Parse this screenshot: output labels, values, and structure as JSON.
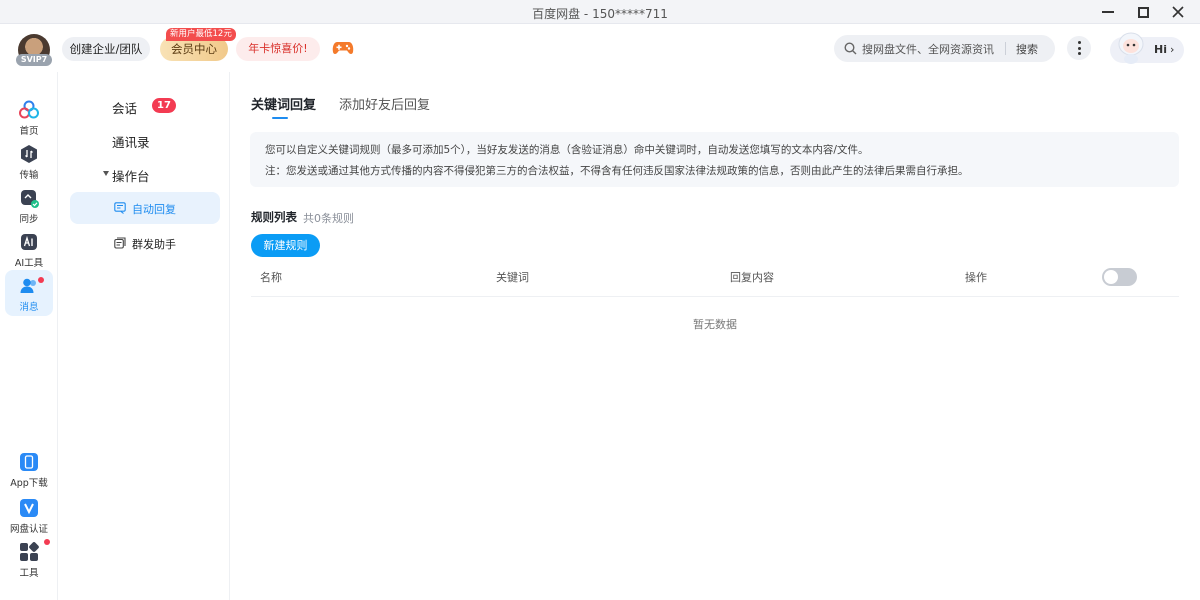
{
  "window": {
    "title": "百度网盘 - 150*****711"
  },
  "header": {
    "vip_tag": "SVIP7",
    "enterprise_label": "创建企业/团队",
    "member_label": "会员中心",
    "new_user_badge": "新用户最低12元",
    "promo_label": "年卡惊喜价!",
    "search_placeholder": "搜网盘文件、全网资源资讯",
    "search_button": "搜索",
    "hi_label": "Hi",
    "hi_chevron": "›"
  },
  "rail": {
    "items": [
      {
        "label": "首页"
      },
      {
        "label": "传输"
      },
      {
        "label": "同步"
      },
      {
        "label": "AI工具"
      },
      {
        "label": "消息"
      }
    ],
    "bottom": [
      {
        "label": "App下载"
      },
      {
        "label": "网盘认证"
      },
      {
        "label": "工具"
      }
    ]
  },
  "subnav": {
    "chat_label": "会话",
    "chat_count": "17",
    "contacts_label": "通讯录",
    "console_label": "操作台",
    "auto_reply_label": "自动回复",
    "broadcast_label": "群发助手"
  },
  "main": {
    "tabs": [
      "关键词回复",
      "添加好友后回复"
    ],
    "notice_line1": "您可以自定义关键词规则（最多可添加5个），当好友发送的消息（含验证消息）命中关键词时，自动发送您填写的文本内容/文件。",
    "notice_line2": "注：您发送或通过其他方式传播的内容不得侵犯第三方的合法权益，不得含有任何违反国家法律法规政策的信息，否则由此产生的法律后果需自行承担。",
    "rules_title": "规则列表",
    "rules_count": "共0条规则",
    "new_rule_button": "新建规则",
    "columns": [
      "名称",
      "关键词",
      "回复内容",
      "操作"
    ],
    "toggle_on": false,
    "empty_text": "暂无数据"
  },
  "colors": {
    "accent": "#1e8cf0",
    "primary_button": "#0b9cf5",
    "badge_red": "#f33b52"
  }
}
